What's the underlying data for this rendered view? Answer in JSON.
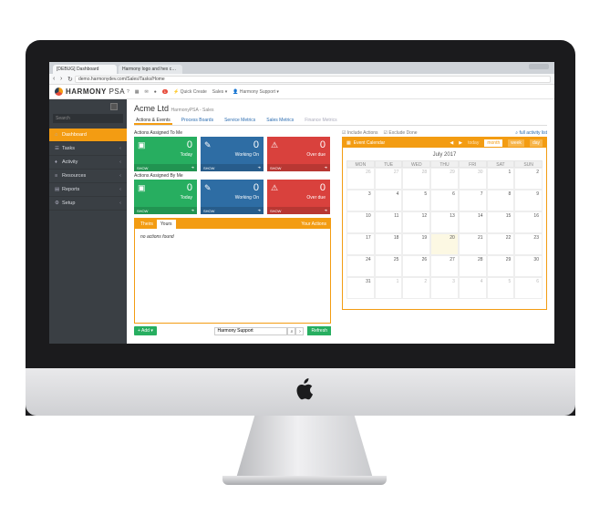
{
  "browser": {
    "tabs": [
      "[DEBUG] Dashboard",
      "Harmony logo and hex c…"
    ],
    "url": "demo.harmonydev.com/Sales/Tasks/Home"
  },
  "app": {
    "brand_bold": "HARMONY",
    "brand_light": "PSA",
    "quick_create": "Quick Create",
    "sales_menu": "Sales",
    "user": "Harmony Support",
    "notif_count": "1"
  },
  "sidebar": {
    "search_placeholder": "Search",
    "items": [
      {
        "label": "Dashboard",
        "icon": "home-icon",
        "active": true
      },
      {
        "label": "Tasks",
        "icon": "list-icon"
      },
      {
        "label": "Activity",
        "icon": "pulse-icon"
      },
      {
        "label": "Resources",
        "icon": "database-icon"
      },
      {
        "label": "Reports",
        "icon": "chart-icon"
      },
      {
        "label": "Setup",
        "icon": "cog-icon"
      }
    ]
  },
  "page": {
    "title": "Acme Ltd",
    "subtitle": "HarmonyPSA - Sales"
  },
  "tabs": [
    "Actions & Events",
    "Process Boards",
    "Service Metrics",
    "Sales Metrics",
    "Finance Metrics"
  ],
  "assigned_to_me": {
    "heading": "Actions Assigned To Me",
    "tiles": [
      {
        "value": "0",
        "label": "Today",
        "footer": "SHOW"
      },
      {
        "value": "0",
        "label": "Working On",
        "footer": "SHOW"
      },
      {
        "value": "0",
        "label": "Over due",
        "footer": "SHOW"
      }
    ]
  },
  "assigned_by_me": {
    "heading": "Actions Assigned By Me",
    "tiles": [
      {
        "value": "0",
        "label": "Today",
        "footer": "SHOW"
      },
      {
        "value": "0",
        "label": "Working On",
        "footer": "SHOW"
      },
      {
        "value": "0",
        "label": "Over due",
        "footer": "SHOW"
      }
    ]
  },
  "actions_panel": {
    "tab_theirs": "Theirs",
    "tab_yours": "Yours",
    "title": "Your Actions",
    "empty": "no actions found"
  },
  "footer": {
    "add": "Add",
    "user_filter": "Harmony Support",
    "refresh": "Refresh"
  },
  "calendar_tools": {
    "include": "Include Actions",
    "exclude": "Exclude Done",
    "full_list": "full activity list"
  },
  "calendar": {
    "title": "Event Calendar",
    "today": "today",
    "month_label": "month",
    "week_label": "week",
    "day_label": "day",
    "month": "July 2017",
    "days": [
      "MON",
      "TUE",
      "WED",
      "THU",
      "FRI",
      "SAT",
      "SUN"
    ],
    "weeks": [
      [
        "26",
        "27",
        "28",
        "29",
        "30",
        "1",
        "2"
      ],
      [
        "3",
        "4",
        "5",
        "6",
        "7",
        "8",
        "9"
      ],
      [
        "10",
        "11",
        "12",
        "13",
        "14",
        "15",
        "16"
      ],
      [
        "17",
        "18",
        "19",
        "20",
        "21",
        "22",
        "23"
      ],
      [
        "24",
        "25",
        "26",
        "27",
        "28",
        "29",
        "30"
      ],
      [
        "31",
        "1",
        "2",
        "3",
        "4",
        "5",
        "6"
      ]
    ]
  }
}
